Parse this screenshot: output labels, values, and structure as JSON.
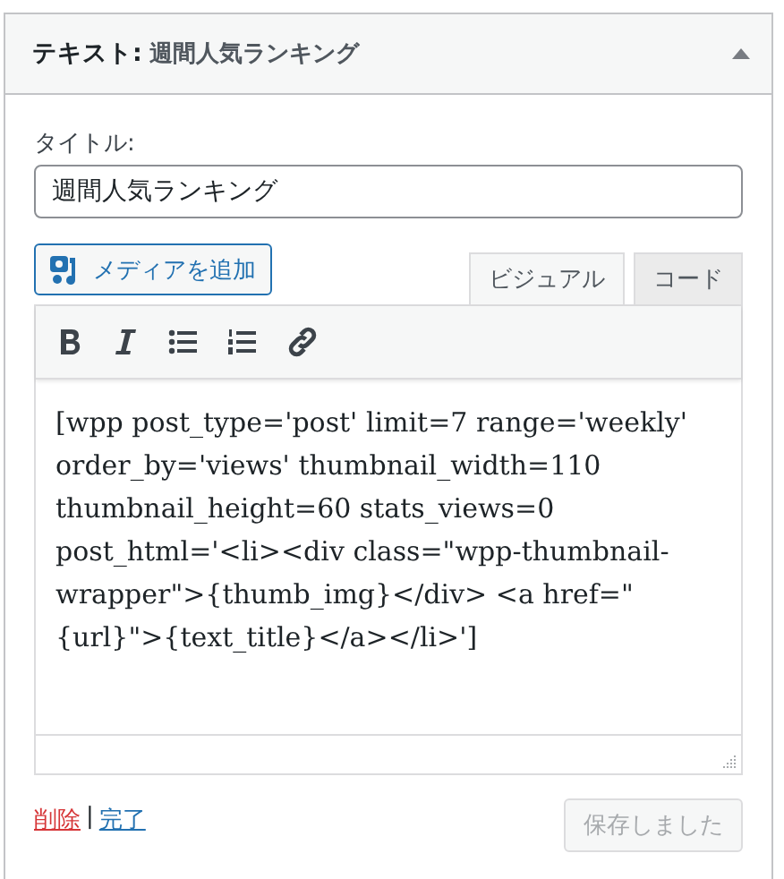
{
  "widget": {
    "kind_label": "テキスト:",
    "title": "週間人気ランキング",
    "expanded": true
  },
  "title_field": {
    "label": "タイトル:",
    "value": "週間人気ランキング"
  },
  "add_media_button": "メディアを追加",
  "editor_tabs": [
    {
      "label": "ビジュアル",
      "selected": true
    },
    {
      "label": "コード",
      "selected": false
    }
  ],
  "toolbar": [
    {
      "kind": "bold"
    },
    {
      "kind": "italic"
    },
    {
      "kind": "bulleted-list"
    },
    {
      "kind": "numbered-list"
    },
    {
      "kind": "link"
    }
  ],
  "content": "[wpp post_type='post' limit=7 range='weekly' order_by='views' thumbnail_width=110 thumbnail_height=60 stats_views=0 post_html='<li><div class=\"wpp-thumbnail-wrapper\">{thumb_img}</div> <a href=\"{url}\">{text_title}</a></li>']",
  "footer": {
    "delete_link": "削除",
    "separator": "|",
    "done_link": "完了",
    "save_button": {
      "label": "保存しました",
      "disabled": true
    }
  }
}
